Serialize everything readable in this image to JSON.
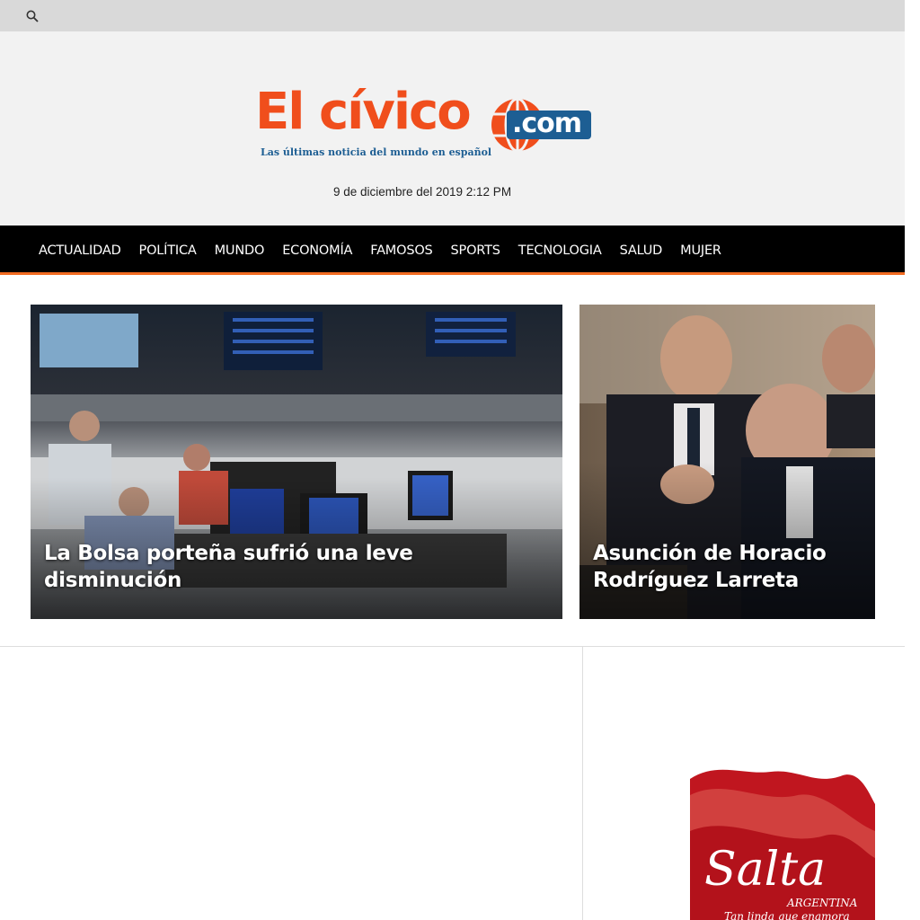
{
  "topbar": {
    "search_icon": "search-icon"
  },
  "logo": {
    "name_part": "El cívico",
    "com_part": ".com",
    "tagline_part1": "Las últimas noticia del mundo en ",
    "tagline_part2": "español"
  },
  "header": {
    "date": "9 de diciembre del 2019 2:12 PM"
  },
  "nav": {
    "items": [
      "ACTUALIDAD",
      "POLÍTICA",
      "MUNDO",
      "ECONOMÍA",
      "FAMOSOS",
      "SPORTS",
      "TECNOLOGIA",
      "SALUD",
      "MUJER"
    ]
  },
  "featured": [
    {
      "title": "La Bolsa porteña sufrió una leve disminución"
    },
    {
      "title": "Asunción de Horacio Rodríguez Larreta"
    }
  ],
  "ad": {
    "title": "Salta",
    "country": "ARGENTINA",
    "slogan": "Tan linda que enamora"
  },
  "colors": {
    "brand_orange": "#f04e1c",
    "brand_blue": "#1d5e93",
    "nav_bg": "#000000",
    "nav_accent": "#f26b21"
  }
}
